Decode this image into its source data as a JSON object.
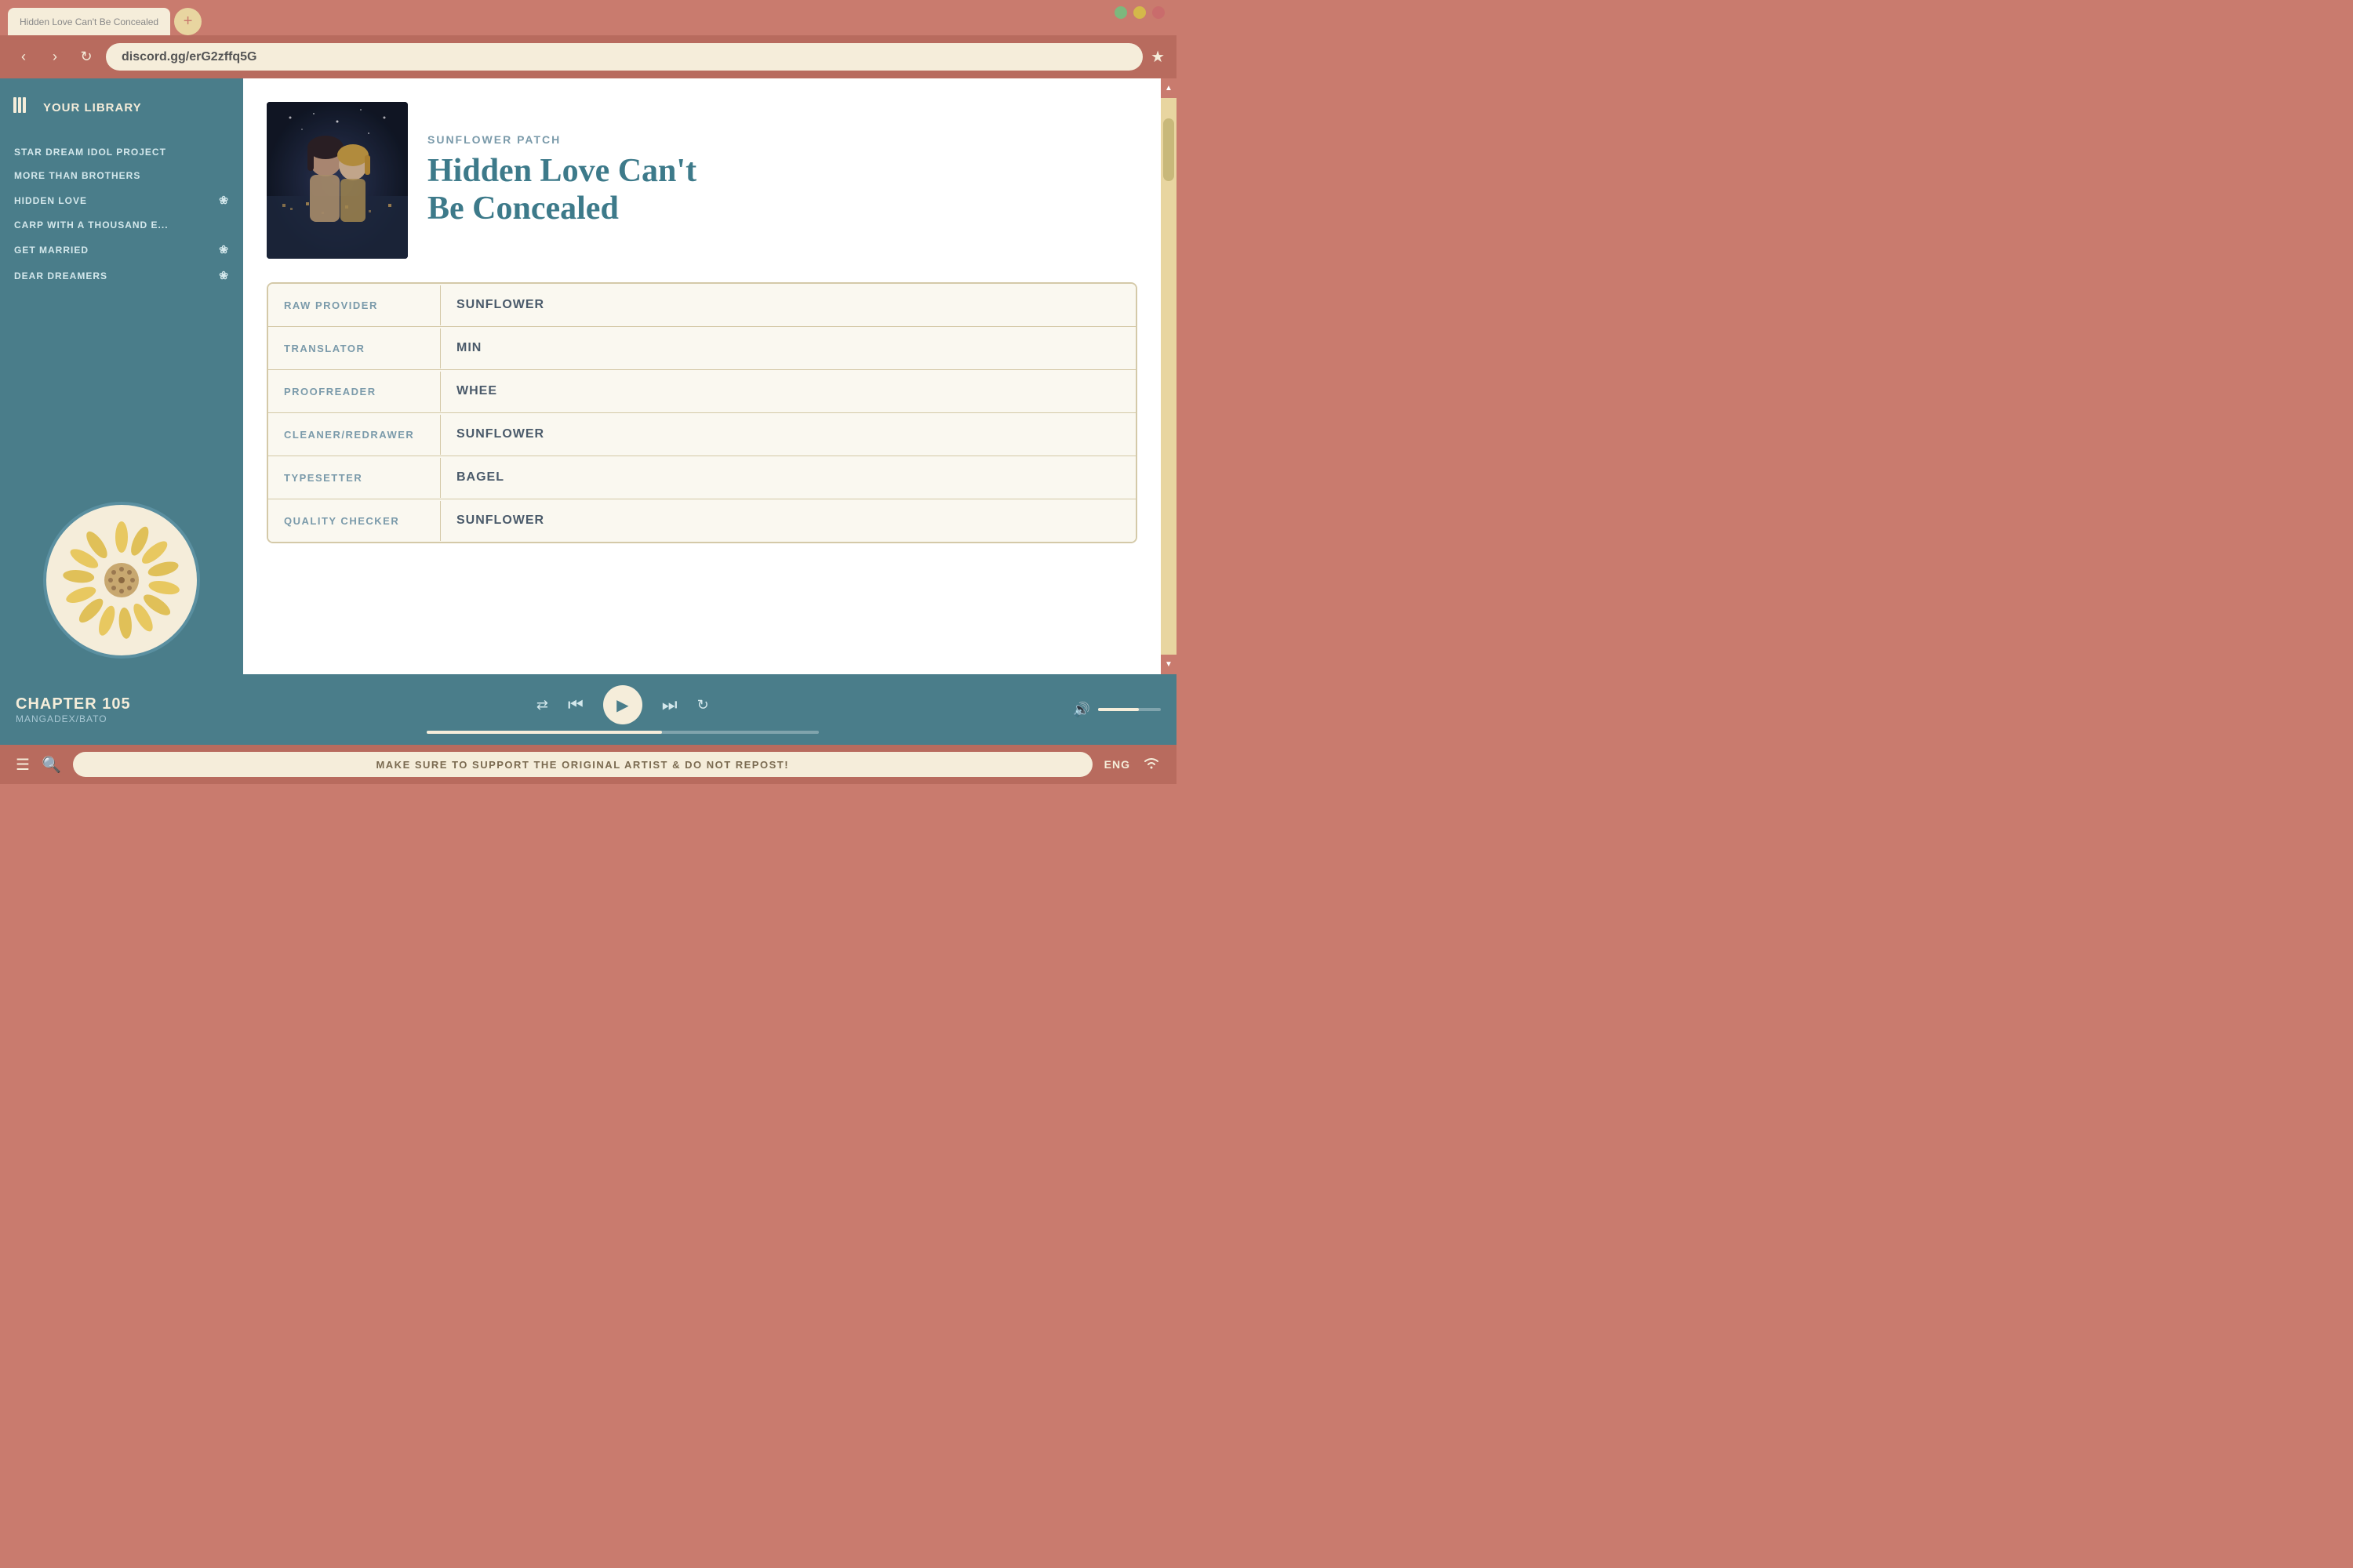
{
  "browser": {
    "url": "discord.gg/erG2zffq5G",
    "tab_title": "Hidden Love Can't Be Concealed"
  },
  "window_controls": {
    "green_label": "●",
    "yellow_label": "●",
    "red_label": "●"
  },
  "nav": {
    "back": "‹",
    "forward": "›",
    "refresh": "↻",
    "bookmark": "★"
  },
  "sidebar": {
    "title": "YOUR LIBRARY",
    "items": [
      {
        "label": "STAR DREAM IDOL PROJECT",
        "has_icon": false
      },
      {
        "label": "MORE THAN BROTHERS",
        "has_icon": false
      },
      {
        "label": "HIDDEN LOVE",
        "has_icon": true
      },
      {
        "label": "CARP WITH A THOUSAND E...",
        "has_icon": false
      },
      {
        "label": "GET MARRIED",
        "has_icon": true
      },
      {
        "label": "DEAR DREAMERS",
        "has_icon": true
      }
    ]
  },
  "manga": {
    "publisher": "SUNFLOWER PATCH",
    "title_line1": "Hidden Love Can't",
    "title_line2": "Be Concealed",
    "credits": [
      {
        "label": "RAW PROVIDER",
        "value": "SUNFLOWER"
      },
      {
        "label": "TRANSLATOR",
        "value": "MIN"
      },
      {
        "label": "PROOFREADER",
        "value": "WHEE"
      },
      {
        "label": "CLEANER/REDRAWER",
        "value": "SUNFLOWER"
      },
      {
        "label": "TYPESETTER",
        "value": "BAGEL"
      },
      {
        "label": "QUALITY CHECKER",
        "value": "SUNFLOWER"
      }
    ]
  },
  "player": {
    "chapter": "CHAPTER 105",
    "source": "MANGADEX/BATO",
    "shuffle_icon": "⇄",
    "prev_icon": "⏮",
    "play_icon": "▶",
    "next_icon": "⏭",
    "repeat_icon": "↻",
    "volume_icon": "🔊"
  },
  "status_bar": {
    "menu_icon": "☰",
    "search_icon": "🔍",
    "message": "MAKE SURE TO SUPPORT THE ORIGINAL ARTIST & DO NOT REPOST!",
    "language": "ENG",
    "wifi_icon": "📶"
  },
  "scrollbar": {
    "up": "▲",
    "down": "▼"
  }
}
